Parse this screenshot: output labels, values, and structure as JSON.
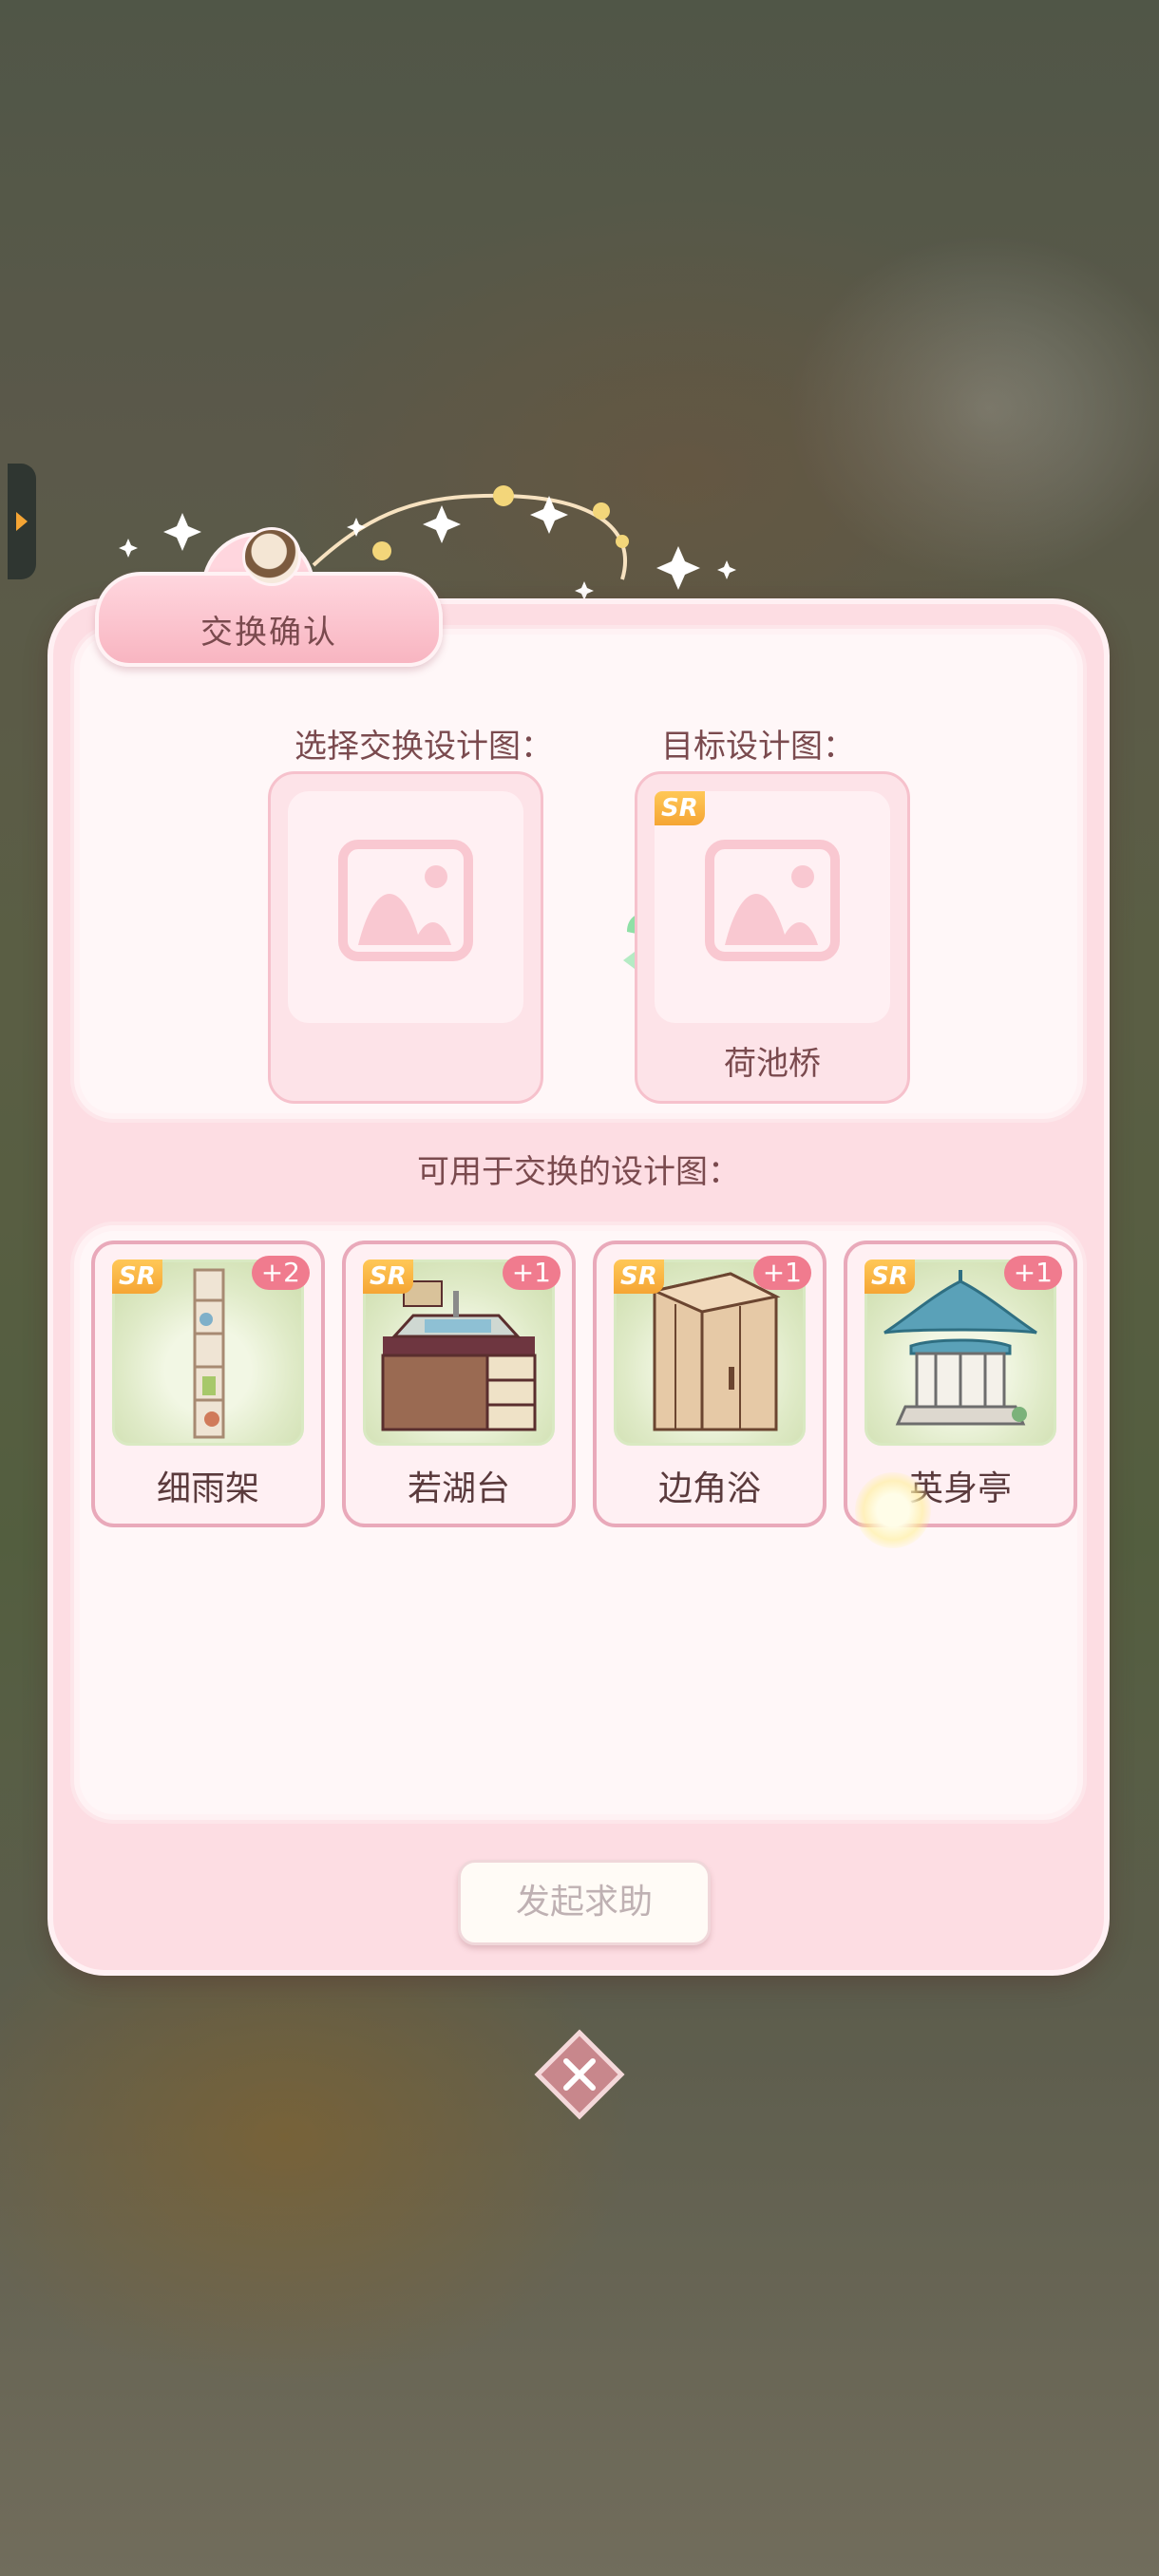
{
  "dialog": {
    "title": "交换确认",
    "select_label": "选择交换设计图：",
    "target_label": "目标设计图：",
    "available_label": "可用于交换的设计图：",
    "target": {
      "rarity": "SR",
      "name": "荷池桥"
    },
    "help_button": "发起求助"
  },
  "blueprints": [
    {
      "rarity": "SR",
      "count": "+2",
      "name": "细雨架",
      "icon": "shelf-icon"
    },
    {
      "rarity": "SR",
      "count": "+1",
      "name": "若湖台",
      "icon": "sink-cabinet-icon"
    },
    {
      "rarity": "SR",
      "count": "+1",
      "name": "边角浴",
      "icon": "shower-cabin-icon"
    },
    {
      "rarity": "SR",
      "count": "+1",
      "name": "英身亭",
      "icon": "pavilion-icon"
    }
  ],
  "colors": {
    "accent": "#f07b8e",
    "panel": "#fddde3",
    "rarity": "#f5a534",
    "swap": "#8fe0a6"
  }
}
